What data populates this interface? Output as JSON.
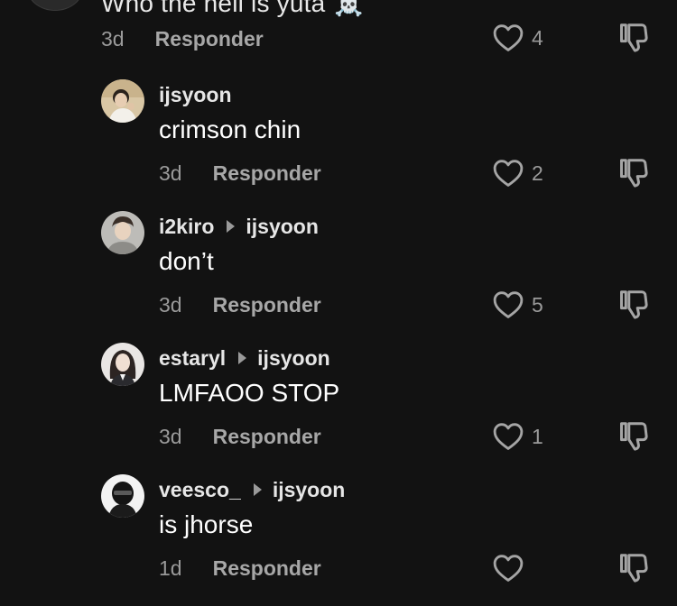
{
  "top_comment": {
    "text_partial": "Who the hell is yuta",
    "emoji": "☠️",
    "time": "3d",
    "reply_label": "Responder",
    "likes": "4"
  },
  "replies": [
    {
      "username": "ijsyoon",
      "reply_to": "",
      "text": "crimson chin",
      "time": "3d",
      "reply_label": "Responder",
      "likes": "2"
    },
    {
      "username": "i2kiro",
      "reply_to": "ijsyoon",
      "text": "don’t",
      "time": "3d",
      "reply_label": "Responder",
      "likes": "5"
    },
    {
      "username": "estaryl",
      "reply_to": "ijsyoon",
      "text": "LMFAOO STOP",
      "time": "3d",
      "reply_label": "Responder",
      "likes": "1"
    },
    {
      "username": "veesco_",
      "reply_to": "ijsyoon",
      "text": "is jhorse",
      "time": "1d",
      "reply_label": "Responder",
      "likes": ""
    }
  ],
  "icons": {
    "like": "heart-outline-icon",
    "dislike": "thumbs-down-icon",
    "reply_caret": "caret-right-icon"
  },
  "colors": {
    "background": "#121212",
    "text_primary": "#ffffff",
    "text_secondary": "#9a9a9a"
  }
}
